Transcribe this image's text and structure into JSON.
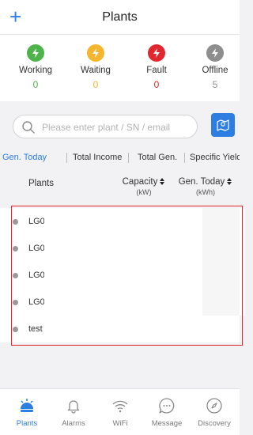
{
  "header": {
    "add_label": "+",
    "title": "Plants"
  },
  "status": [
    {
      "label": "Working",
      "count": "0",
      "color": "#4db34a",
      "icon": "bolt-icon"
    },
    {
      "label": "Waiting",
      "count": "0",
      "color": "#f5b52e",
      "icon": "bolt-icon"
    },
    {
      "label": "Fault",
      "count": "0",
      "color": "#e0282e",
      "icon": "bolt-icon"
    },
    {
      "label": "Offline",
      "count": "5",
      "color": "#8e8e8e",
      "icon": "bolt-icon"
    }
  ],
  "search": {
    "placeholder": "Please enter plant / SN / email",
    "value": "",
    "map_icon": "map-icon"
  },
  "tabs": [
    {
      "label": "Gen. Today",
      "active": true
    },
    {
      "label": "Total Income",
      "active": false
    },
    {
      "label": "Total Gen.",
      "active": false
    },
    {
      "label": "Specific Yield",
      "active": false
    }
  ],
  "table": {
    "headers": {
      "plants": "Plants",
      "capacity": "Capacity",
      "capacity_unit": "(kW)",
      "gen_today": "Gen. Today",
      "gen_today_unit": "(kWh)"
    },
    "rows": [
      {
        "name": "LG0("
      },
      {
        "name": "LG0("
      },
      {
        "name": "LG0("
      },
      {
        "name": "LG0("
      },
      {
        "name": "test"
      }
    ]
  },
  "tabbar": [
    {
      "label": "Plants",
      "icon": "plants-icon",
      "active": true
    },
    {
      "label": "Alarms",
      "icon": "bell-icon",
      "active": false
    },
    {
      "label": "WiFi",
      "icon": "wifi-icon",
      "active": false
    },
    {
      "label": "Message",
      "icon": "message-icon",
      "active": false
    },
    {
      "label": "Discovery",
      "icon": "compass-icon",
      "active": false
    }
  ],
  "colors": {
    "accent": "#2e7de1",
    "highlight_box": "#e0282e"
  }
}
